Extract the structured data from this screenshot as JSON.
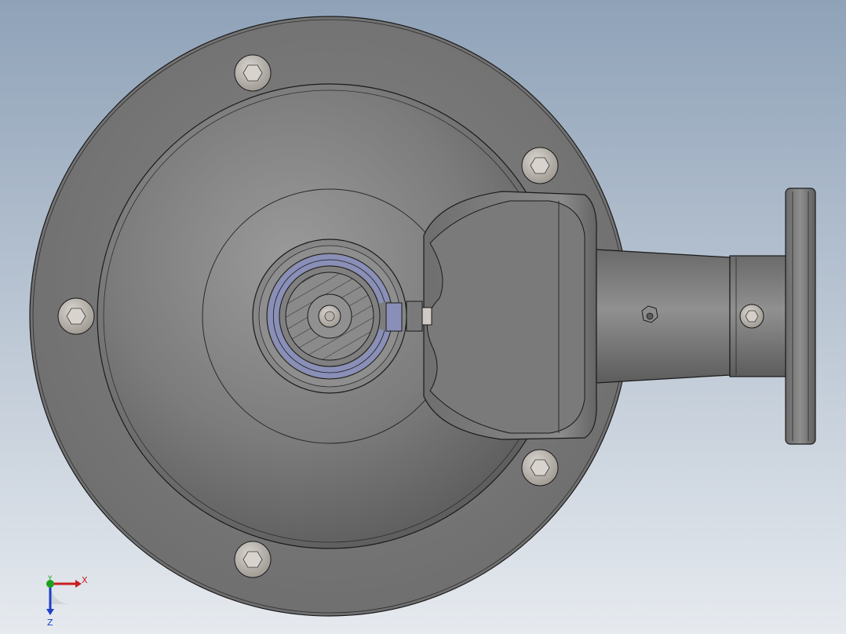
{
  "viewport": {
    "background_top": "#8fa2b8",
    "background_bottom": "#e8ecf0",
    "part_color": "#7f7f7f",
    "edge_color": "#1a1a1a",
    "bolt_color": "#b9b4ae",
    "bearing_color": "#8a8fb8"
  },
  "triad": {
    "x_label": "X",
    "y_label": "Y",
    "z_label": "Z",
    "x_color": "#c81e1e",
    "y_color": "#1ea01e",
    "z_color": "#1e3ec8"
  },
  "model": {
    "icons": [
      "pump-housing",
      "flange-bolt-icon",
      "outlet-flange",
      "shaft-end",
      "nut-icon"
    ]
  }
}
